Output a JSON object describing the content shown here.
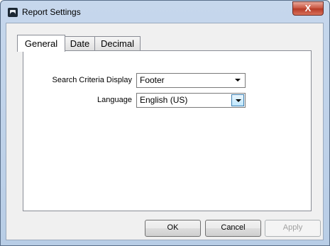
{
  "window": {
    "title": "Report Settings",
    "close_label": "X"
  },
  "tabs": [
    {
      "label": "General",
      "active": true
    },
    {
      "label": "Date",
      "active": false
    },
    {
      "label": "Decimal",
      "active": false
    }
  ],
  "general": {
    "search_criteria_label": "Search Criteria Display",
    "search_criteria_value": "Footer",
    "language_label": "Language",
    "language_value": "English (US)"
  },
  "buttons": {
    "ok": "OK",
    "cancel": "Cancel",
    "apply": "Apply"
  }
}
